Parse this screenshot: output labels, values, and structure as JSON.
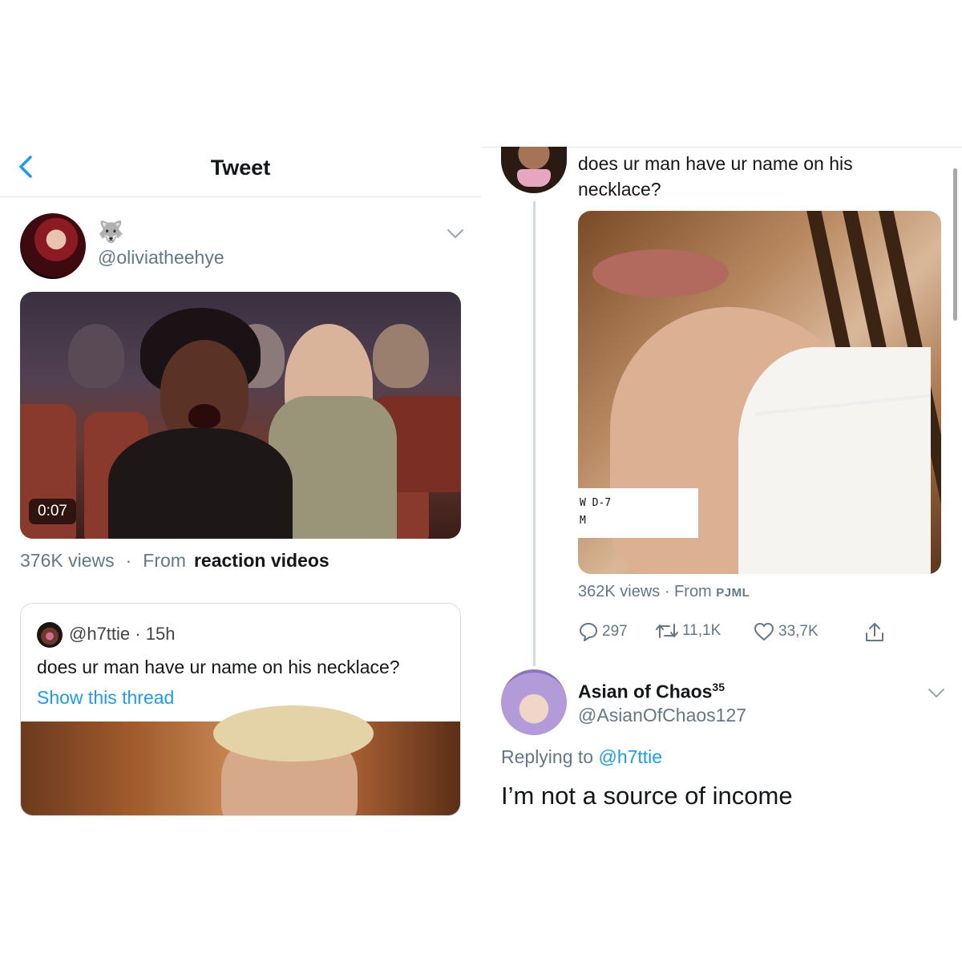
{
  "left": {
    "nav_title": "Tweet",
    "author": {
      "emoji": "🐺",
      "handle": "@oliviatheehye"
    },
    "video": {
      "duration": "0:07"
    },
    "views": {
      "count": "376K views",
      "separator": "·",
      "from": "From",
      "source": "reaction videos"
    },
    "quote": {
      "handle": "@h7ttie",
      "time": "15h",
      "separator": "·",
      "text": "does ur man have ur name on his necklace?",
      "link": "Show this thread"
    }
  },
  "right": {
    "tweet_text": "does ur man have ur name on his necklace?",
    "media_caption_line1": "W D-7",
    "media_caption_line2": "M",
    "views": {
      "count": "362K views",
      "from": "· From",
      "source": "PJML"
    },
    "actions": {
      "replies": "297",
      "retweets": "11,1K",
      "likes": "33,7K"
    },
    "reply": {
      "name": "Asian of Chaos",
      "name_superscript": "35",
      "handle": "@AsianOfChaos127",
      "replying_to_label": "Replying to",
      "replying_to_handle": "@h7ttie",
      "text": "I’m not a source of income"
    }
  }
}
